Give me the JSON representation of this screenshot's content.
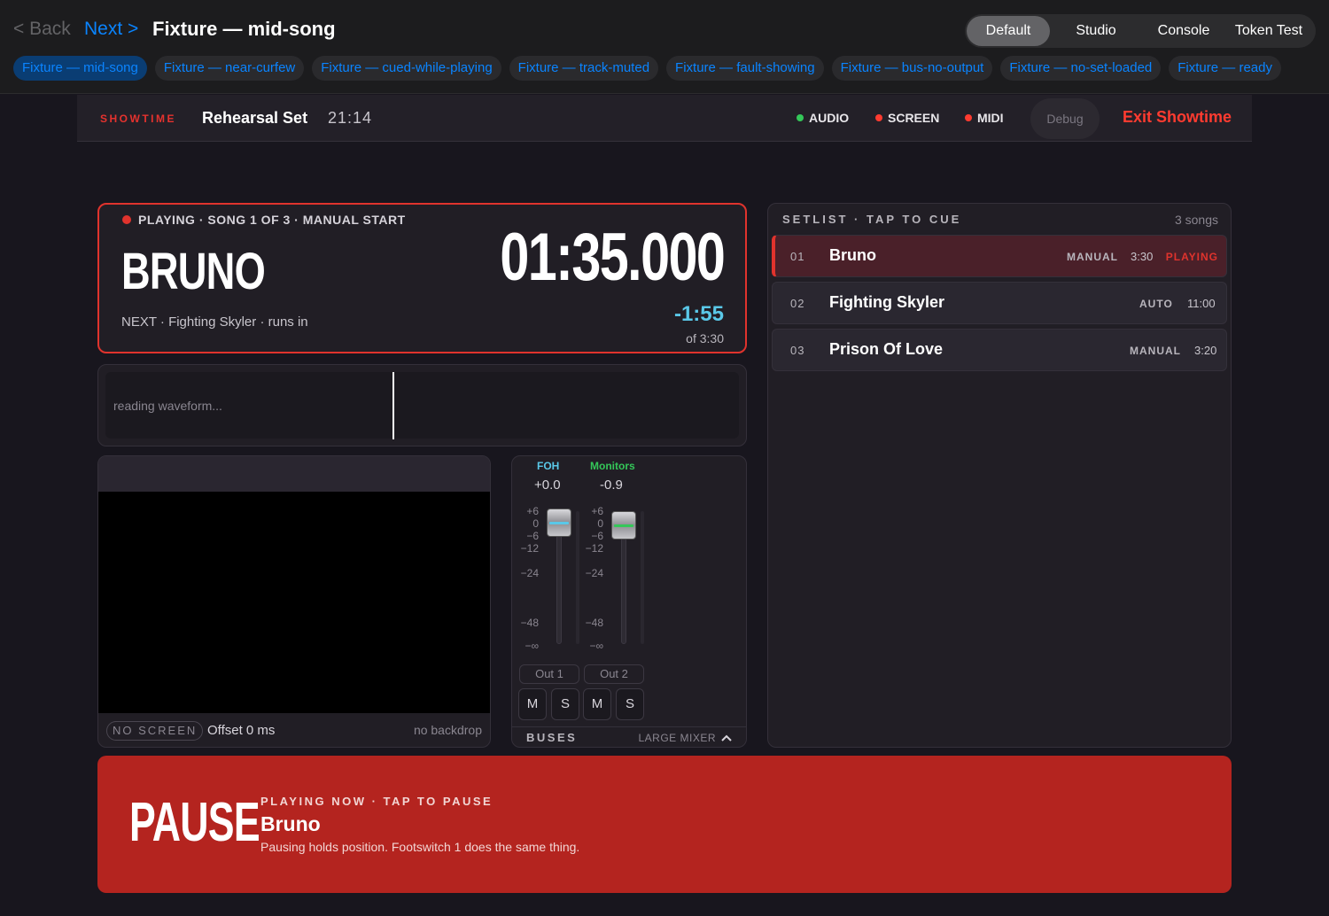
{
  "nav": {
    "back_label": "< Back",
    "next_label": "Next >",
    "title": "Fixture — mid-song",
    "segments": [
      "Default",
      "Studio",
      "Console",
      "Token Test"
    ],
    "active_segment": "Default",
    "fixtures": [
      "Fixture — mid-song",
      "Fixture — near-curfew",
      "Fixture — cued-while-playing",
      "Fixture — track-muted",
      "Fixture — fault-showing",
      "Fixture — bus-no-output",
      "Fixture — no-set-loaded",
      "Fixture — ready"
    ]
  },
  "header": {
    "mode_label": "SHOWTIME",
    "set_name": "Rehearsal Set",
    "clock": "21:14",
    "status": [
      {
        "label": "AUDIO",
        "color": "#34c759"
      },
      {
        "label": "SCREEN",
        "color": "#ff3b30"
      },
      {
        "label": "MIDI",
        "color": "#ff3b30"
      }
    ],
    "debug_label": "Debug",
    "exit_label": "Exit Showtime"
  },
  "now_playing": {
    "status": "PLAYING · SONG 1 OF 3 · MANUAL START",
    "title": "BRUNO",
    "next": "NEXT · Fighting Skyler · runs in",
    "elapsed": "01:35.000",
    "remaining": "-1:55",
    "total": "of 3:30",
    "accent": "#e0332d"
  },
  "waveform": {
    "status": "reading waveform..."
  },
  "screen": {
    "badge": "NO SCREEN",
    "offset": "Offset 0 ms",
    "backdrop": "no backdrop"
  },
  "mixer": {
    "channels": [
      {
        "name": "FOH",
        "value": "+0.0",
        "color": "#5ac8e8",
        "out": "Out 1",
        "mute": "M",
        "solo": "S"
      },
      {
        "name": "Monitors",
        "value": "-0.9",
        "color": "#34c759",
        "out": "Out 2",
        "mute": "M",
        "solo": "S"
      }
    ],
    "scale": [
      "+6",
      "0",
      "−6",
      "−12",
      "−24",
      "−48",
      "−∞"
    ],
    "buses_label": "BUSES",
    "large_mixer_label": "LARGE MIXER"
  },
  "setlist": {
    "title": "SETLIST · TAP TO CUE",
    "count": "3 songs",
    "songs": [
      {
        "num": "01",
        "name": "Bruno",
        "mode": "MANUAL",
        "duration": "3:30",
        "state": "PLAYING"
      },
      {
        "num": "02",
        "name": "Fighting Skyler",
        "mode": "AUTO",
        "duration": "11:00",
        "state": ""
      },
      {
        "num": "03",
        "name": "Prison Of Love",
        "mode": "MANUAL",
        "duration": "3:20",
        "state": ""
      }
    ]
  },
  "pause": {
    "big_label": "PAUSE",
    "label": "PLAYING NOW · TAP TO PAUSE",
    "song": "Bruno",
    "help": "Pausing holds position. Footswitch 1 does the same thing."
  }
}
